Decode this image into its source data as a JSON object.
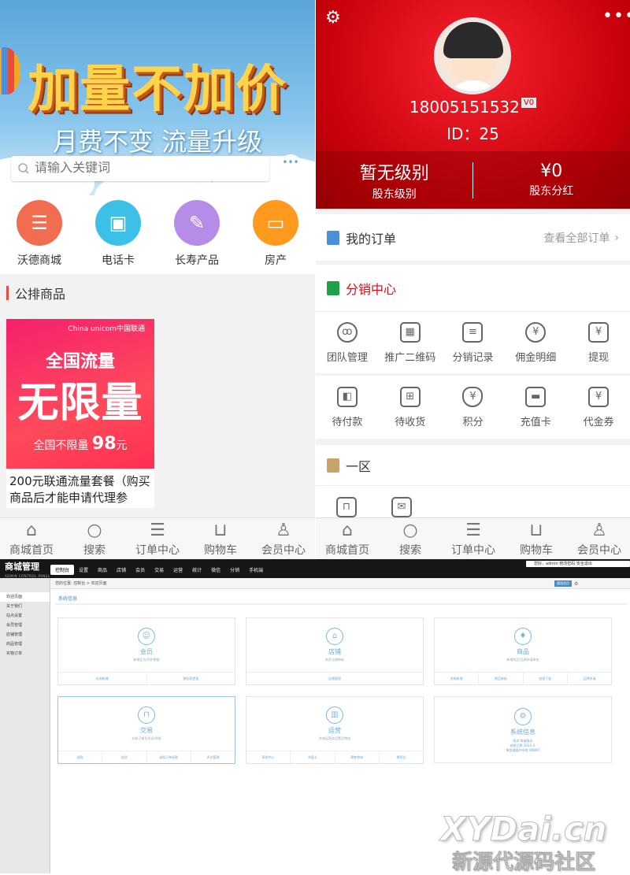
{
  "left": {
    "banner": {
      "headline": "加量不加价",
      "subline": "月费不变  流量升级"
    },
    "search": {
      "placeholder": "请输入关键词"
    },
    "categories": [
      {
        "label": "沃德商城",
        "color": "#f26c50",
        "icon": "list-icon"
      },
      {
        "label": "电话卡",
        "color": "#3cc0e8",
        "icon": "card-icon"
      },
      {
        "label": "长寿产品",
        "color": "#b58ce8",
        "icon": "edit-icon"
      },
      {
        "label": "房产",
        "color": "#ff9a1f",
        "icon": "house-icon"
      }
    ],
    "section_title": "公排商品",
    "product": {
      "image_line1": "全国流量",
      "image_line2": "无限量",
      "image_line3_text": "全国不限量",
      "image_line3_num": "98",
      "image_line3_unit": "元",
      "brand": "China unicom中国联通",
      "title": "200元联通流量套餐（购买商品后才能申请代理参"
    }
  },
  "tabbar": [
    {
      "label": "商城首页",
      "icon": "home-icon"
    },
    {
      "label": "搜索",
      "icon": "search-icon"
    },
    {
      "label": "订单中心",
      "icon": "order-icon"
    },
    {
      "label": "购物车",
      "icon": "cart-icon"
    },
    {
      "label": "会员中心",
      "icon": "user-icon"
    }
  ],
  "right": {
    "phone": "18005151532",
    "vip": "V0",
    "id_text": "ID：25",
    "stats": [
      {
        "value": "暂无级别",
        "label": "股东级别"
      },
      {
        "value": "¥0",
        "label": "股东分红"
      }
    ],
    "orders": {
      "title": "我的订单",
      "more": "查看全部订单"
    },
    "dist": {
      "title": "分销中心",
      "items": [
        "团队管理",
        "推广二维码",
        "分销记录",
        "佣金明细",
        "提现"
      ]
    },
    "wallet": {
      "items": [
        "待付款",
        "待收货",
        "积分",
        "充值卡",
        "代金券"
      ]
    },
    "zone": {
      "title": "一区"
    }
  },
  "admin": {
    "logo": "商城管理",
    "logo_sub": "ADMIN CONTROL PANEL",
    "nav": [
      "控制台",
      "设置",
      "商品",
      "店铺",
      "会员",
      "交易",
      "运营",
      "统计",
      "微信",
      "分销",
      "手机端"
    ],
    "user": "您好，admin  修改密码  安全退出",
    "breadcrumb": "您的位置: 控制台 > 欢迎页面",
    "btn": "管理首页",
    "side": [
      "欢迎页面",
      "关于我们",
      "站点设置",
      "会员管理",
      "店铺管理",
      "商品管理",
      "实物订单"
    ],
    "section": "系统信息",
    "panels": [
      {
        "name": "会员",
        "desc": "新增会员/同步数据",
        "links": [
          "本周新增",
          "预存款提现"
        ]
      },
      {
        "name": "店铺",
        "desc": "新开店铺审核",
        "links": [
          "店铺管理"
        ]
      },
      {
        "name": "商品",
        "desc": "新增商品/品牌申请审核",
        "links": [
          "本周新增",
          "商品审核",
          "违规下架",
          "品牌申请"
        ]
      },
      {
        "name": "交易",
        "desc": "交易订单及投诉/举报",
        "links": [
          "退款",
          "退货",
          "虚拟订单退款",
          "评论管理"
        ]
      },
      {
        "name": "运营",
        "desc": "系统运营类设置及审核",
        "links": [
          "帮助中心",
          "充值卡",
          "预售审核",
          "推荐位"
        ]
      },
      {
        "name": "系统信息",
        "desc": "",
        "links": []
      }
    ],
    "sysinfo": [
      "版本  商城基本",
      "安装日期  2016-3-",
      "服务器操作系统  WINNT"
    ]
  },
  "watermark": {
    "line1": "XYDai.cn",
    "line2": "新源代源码社区"
  }
}
